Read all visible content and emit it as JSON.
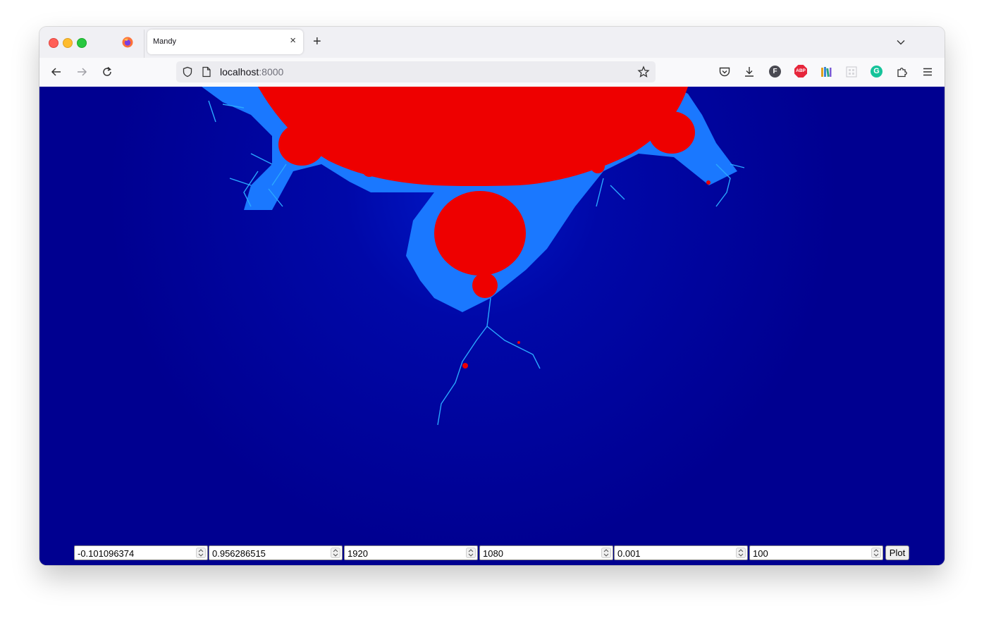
{
  "browser": {
    "tab": {
      "title": "Mandy",
      "close_glyph": "×"
    },
    "new_tab_glyph": "+",
    "url": {
      "host": "localhost",
      "port": ":8000"
    }
  },
  "fractal": {
    "colors": {
      "background": "#000090",
      "set": "#ee0000",
      "edge": "#1a78ff"
    }
  },
  "controls": {
    "inputs": [
      {
        "name": "center-x",
        "value": "-0.101096374"
      },
      {
        "name": "center-y",
        "value": "0.956286515"
      },
      {
        "name": "width",
        "value": "1920"
      },
      {
        "name": "height",
        "value": "1080"
      },
      {
        "name": "scale",
        "value": "0.001"
      },
      {
        "name": "iterations",
        "value": "100"
      }
    ],
    "plot_label": "Plot"
  }
}
